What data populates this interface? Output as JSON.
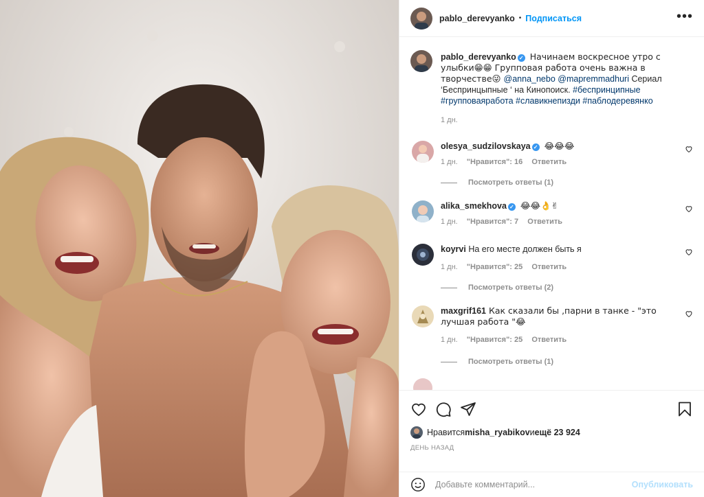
{
  "header": {
    "username": "pablo_derevyanko",
    "follow_label": "Подписаться",
    "separator": "•",
    "more": "•••"
  },
  "caption": {
    "username": "pablo_derevyanko",
    "text_1": " Начинаем воскресное утро с улыбки😁😁 Групповая работа очень важна в творчестве😜 ",
    "mention_1": "@anna_nebo",
    "mention_2": "@mapremmadhuri",
    "text_2": " Сериал ‘Беспринцыпные ‘ на Кинопоиск. ",
    "hashtags": "#беспринципные #групповаяработа #славикнепизди #паблодеревянко",
    "time": "1 дн."
  },
  "comments": [
    {
      "username": "olesya_sudzilovskaya",
      "verified": true,
      "text": " 😂😂😂",
      "time": "1 дн.",
      "likes": "\"Нравится\": 16",
      "reply": "Ответить",
      "replies": "Посмотреть ответы (1)",
      "avatar_color": "#d9a7a7"
    },
    {
      "username": "alika_smekhova",
      "verified": true,
      "text": " 😂😂👌✌",
      "time": "1 дн.",
      "likes": "\"Нравится\": 7",
      "reply": "Ответить",
      "replies": "",
      "avatar_color": "#8fb1c9"
    },
    {
      "username": "koyrvi",
      "verified": false,
      "text": " На его месте должен быть я",
      "time": "1 дн.",
      "likes": "\"Нравится\": 25",
      "reply": "Ответить",
      "replies": "Посмотреть ответы (2)",
      "avatar_color": "#2b2f3a"
    },
    {
      "username": "maxgrif161",
      "verified": false,
      "text": " Как сказали бы ,парни в танке - \"это лучшая работа \"😂",
      "time": "1 дн.",
      "likes": "\"Нравится\": 25",
      "reply": "Ответить",
      "replies": "Посмотреть ответы (1)",
      "avatar_color": "#e9d9b7"
    }
  ],
  "actions": {
    "liked_prefix": "Нравится ",
    "liked_user": "misha_ryabikov",
    "liked_and": " и ",
    "liked_rest": "ещё 23 924",
    "date": "ДЕНЬ НАЗАД",
    "comment_placeholder": "Добавьте комментарий...",
    "post_label": "Опубликовать"
  },
  "icons": [
    "heart-icon",
    "comment-icon",
    "share-icon",
    "bookmark-icon",
    "emoji-icon",
    "verified-icon",
    "more-icon"
  ],
  "colors": {
    "accent": "#0095f6",
    "hashtag": "#00376b",
    "muted": "#8e8e8e",
    "verified": "#3897f0"
  }
}
